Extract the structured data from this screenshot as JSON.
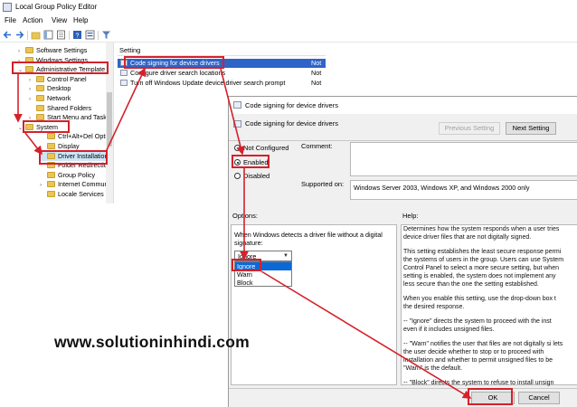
{
  "window": {
    "title": "Local Group Policy Editor",
    "menu": [
      "File",
      "Action",
      "View",
      "Help"
    ]
  },
  "tree": [
    {
      "label": "Software Settings",
      "expander": "›",
      "selected": false
    },
    {
      "label": "Windows Settings",
      "expander": "›",
      "selected": false
    },
    {
      "label": "Administrative Template",
      "expander": "⌄",
      "selected": false
    },
    {
      "label": "Control Panel",
      "expander": "›",
      "selected": false
    },
    {
      "label": "Desktop",
      "expander": "›",
      "selected": false
    },
    {
      "label": "Network",
      "expander": "›",
      "selected": false
    },
    {
      "label": "Shared Folders",
      "expander": "",
      "selected": false
    },
    {
      "label": "Start Menu and Taskb",
      "expander": "›",
      "selected": false
    },
    {
      "label": "System",
      "expander": "⌄",
      "selected": false
    },
    {
      "label": "Ctrl+Alt+Del Opti",
      "expander": "",
      "selected": false
    },
    {
      "label": "Display",
      "expander": "",
      "selected": false
    },
    {
      "label": "Driver Installation",
      "expander": "",
      "selected": true
    },
    {
      "label": "Folder Redirectio",
      "expander": "",
      "selected": false
    },
    {
      "label": "Group Policy",
      "expander": "",
      "selected": false
    },
    {
      "label": "Internet Commun",
      "expander": "›",
      "selected": false
    },
    {
      "label": "Locale Services",
      "expander": "",
      "selected": false
    }
  ],
  "list": {
    "header": "Setting",
    "rows": [
      {
        "label": "Code signing for device drivers",
        "state": "Not",
        "selected": true
      },
      {
        "label": "Configure driver search locations",
        "state": "Not",
        "selected": false
      },
      {
        "label": "Turn off Windows Update device driver search prompt",
        "state": "Not",
        "selected": false
      }
    ]
  },
  "dialog": {
    "title": "Code signing for device drivers",
    "subtitle": "Code signing for device drivers",
    "prev_label": "Previous Setting",
    "next_label": "Next Setting",
    "radios": [
      {
        "label": "Not Configured",
        "checked": false
      },
      {
        "label": "Enabled",
        "checked": true
      },
      {
        "label": "Disabled",
        "checked": false
      }
    ],
    "comment_label": "Comment:",
    "supported_label": "Supported on:",
    "supported_value": "Windows Server 2003, Windows XP, and Windows 2000 only",
    "options_label": "Options:",
    "help_label": "Help:",
    "options_text": "When Windows detects a driver file without a digital signature:",
    "select_value": "Ignore",
    "dropdown_options": [
      {
        "label": "Ignore",
        "selected": true
      },
      {
        "label": "Warn",
        "selected": false
      },
      {
        "label": "Block",
        "selected": false
      }
    ],
    "help_paragraphs": [
      "Determines how the system responds when a user tries device driver files that are not digitally signed.",
      "This setting establishes the least secure response permi the systems of users in the group. Users can use System Control Panel to select a more secure setting, but when setting is enabled, the system does not implement any less secure than the one the setting established.",
      "When you enable this setting, use the drop-down box t the desired response.",
      "-- \"Ignore\" directs the system to proceed with the inst even if it includes unsigned files.",
      "-- \"Warn\" notifies the user that files are not digitally si lets the user decide whether to stop or to proceed with installation and whether to permit unsigned files to be \"Warn\" is the default.",
      "-- \"Block\" directs the system to refuse to install unsign"
    ],
    "ok_label": "OK",
    "cancel_label": "Cancel"
  },
  "watermark": "www.solutioninhindi.com",
  "colors": {
    "annotation": "#d4212b",
    "selection": "#2e64c8",
    "folder": "#e9c456"
  }
}
